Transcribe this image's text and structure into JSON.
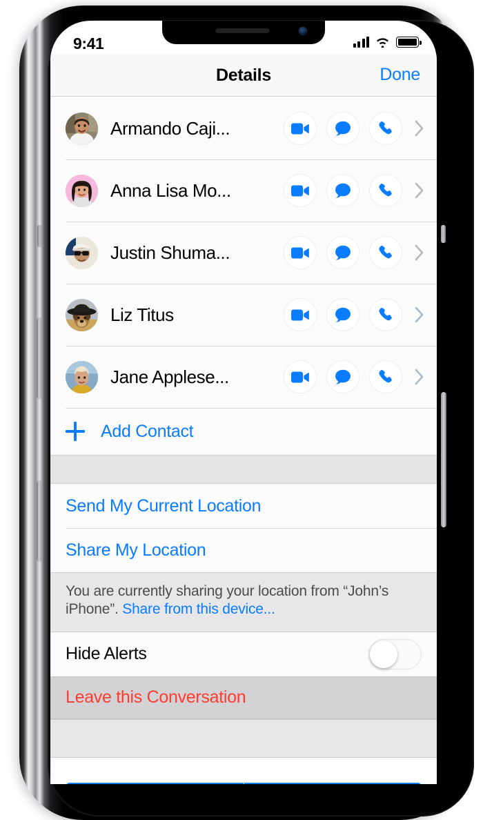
{
  "status_bar": {
    "time": "9:41",
    "signal_icon": "cellular-signal-icon",
    "wifi_icon": "wifi-icon",
    "battery_icon": "battery-full-icon"
  },
  "nav": {
    "title": "Details",
    "done_label": "Done"
  },
  "contacts": {
    "items": [
      {
        "name": "Armando Caji...",
        "avatar_name": "avatar-armando",
        "highlighted": false
      },
      {
        "name": "Anna Lisa Mo...",
        "avatar_name": "avatar-anna-lisa",
        "highlighted": false
      },
      {
        "name": "Justin Shuma...",
        "avatar_name": "avatar-justin",
        "highlighted": false
      },
      {
        "name": "Liz Titus",
        "avatar_name": "avatar-liz",
        "highlighted": true
      },
      {
        "name": "Jane Applese...",
        "avatar_name": "avatar-jane",
        "highlighted": true
      }
    ],
    "action_icons": {
      "video": "facetime-video-icon",
      "message": "message-bubble-icon",
      "phone": "phone-handset-icon",
      "disclosure": "chevron-right-icon"
    },
    "add_contact_label": "Add Contact",
    "add_contact_icon": "plus-icon"
  },
  "location": {
    "send_current_label": "Send My Current Location",
    "share_label": "Share My Location",
    "footer_text_before": "You are currently sharing your location from “John’s iPhone”. ",
    "footer_link": "Share from this device..."
  },
  "alerts": {
    "hide_alerts_label": "Hide Alerts",
    "toggle_state": "off"
  },
  "leave": {
    "label": "Leave this Conversation"
  },
  "colors": {
    "tint_blue": "#0a7cff",
    "destructive_red": "#ff3b30",
    "group_background": "#efeff4",
    "highlight_blue": "#96c8f8"
  }
}
